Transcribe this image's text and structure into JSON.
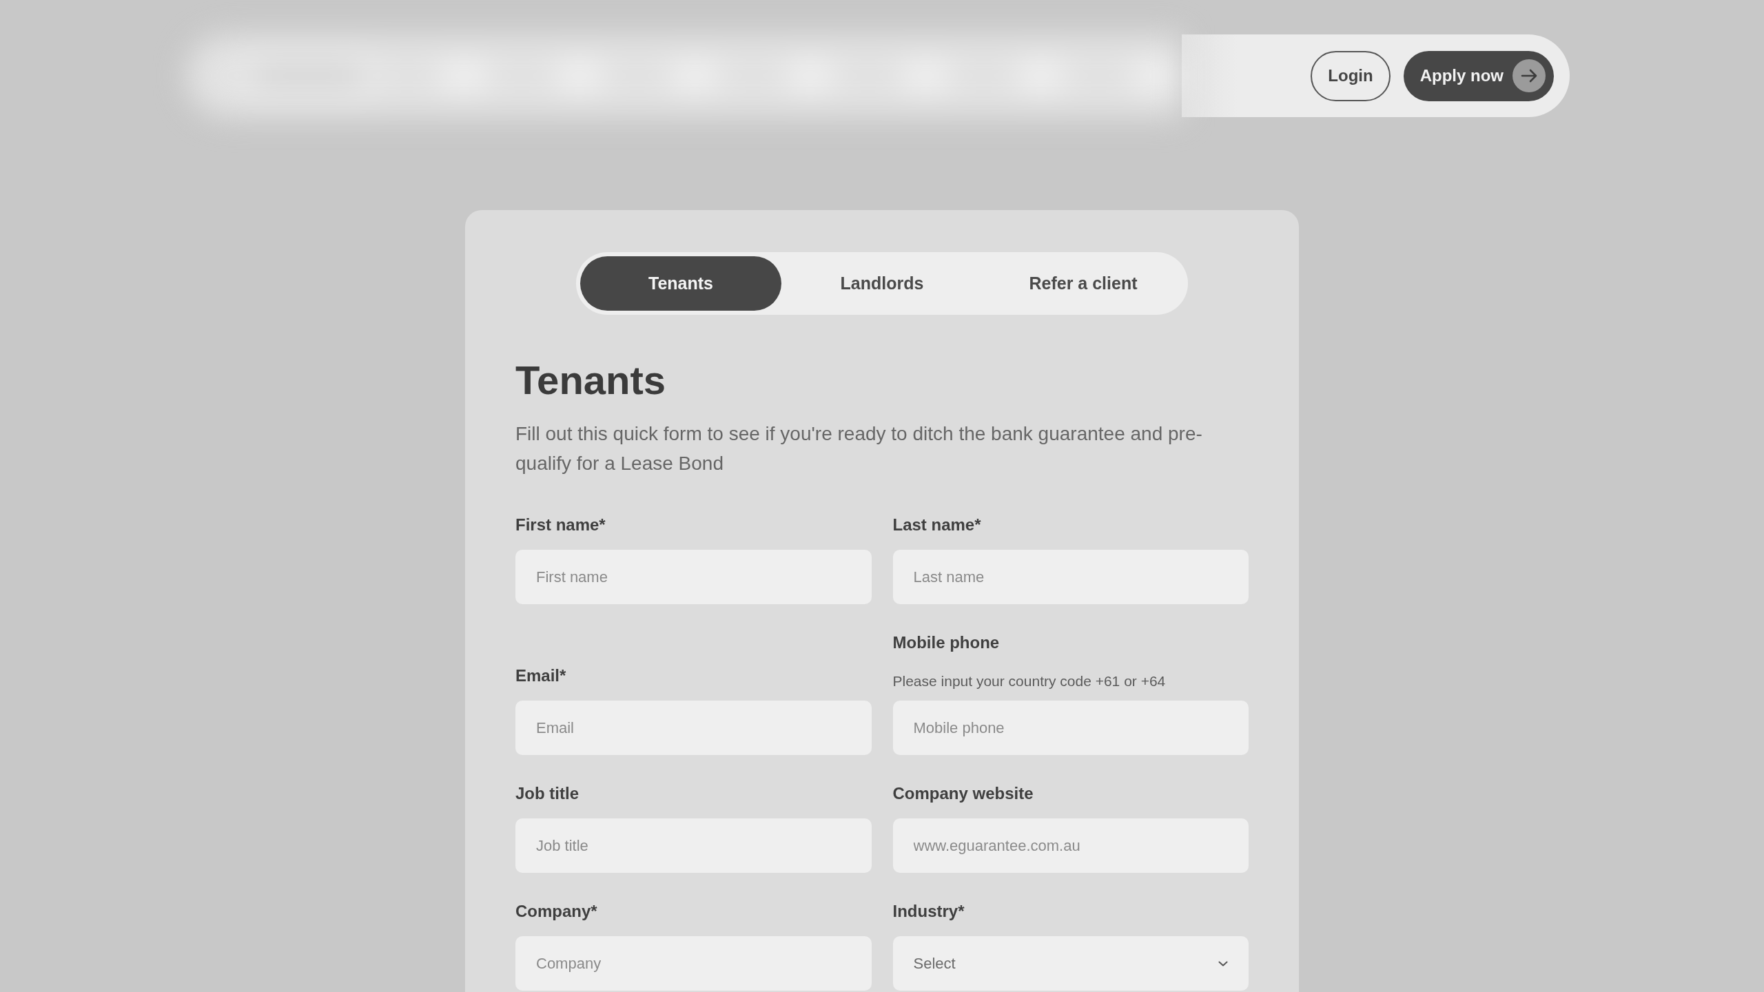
{
  "nav": {
    "buttons": [
      {
        "label": "Login",
        "kind": "outline"
      },
      {
        "label": "Apply now",
        "kind": "primary"
      }
    ]
  },
  "tabs": [
    {
      "label": "Tenants",
      "selected": true
    },
    {
      "label": "Landlords",
      "selected": false
    },
    {
      "label": "Refer a client",
      "selected": false
    }
  ],
  "form": {
    "title": "Tenants",
    "intro": "Fill out this quick form to see if you're ready to ditch the bank guarantee and pre-qualify for a Lease Bond",
    "rows": [
      {
        "fields": [
          {
            "kind": "text",
            "label": "First name*",
            "placeholder": "First name"
          },
          {
            "kind": "text",
            "label": "Last name*",
            "placeholder": "Last name"
          }
        ]
      },
      {
        "fields": [
          {
            "kind": "text",
            "label": "Email*",
            "placeholder": "Email"
          },
          {
            "kind": "text",
            "label": "Mobile phone",
            "hint": "Please input your country code +61 or +64",
            "placeholder": "Mobile phone"
          }
        ]
      },
      {
        "fields": [
          {
            "kind": "text",
            "label": "Job title",
            "placeholder": "Job title"
          },
          {
            "kind": "text",
            "label": "Company website",
            "placeholder": "www.eguarantee.com.au"
          }
        ]
      },
      {
        "fields": [
          {
            "kind": "text",
            "label": "Company*",
            "placeholder": "Company"
          },
          {
            "kind": "select",
            "label": "Industry*",
            "value": "Select"
          }
        ]
      }
    ]
  }
}
